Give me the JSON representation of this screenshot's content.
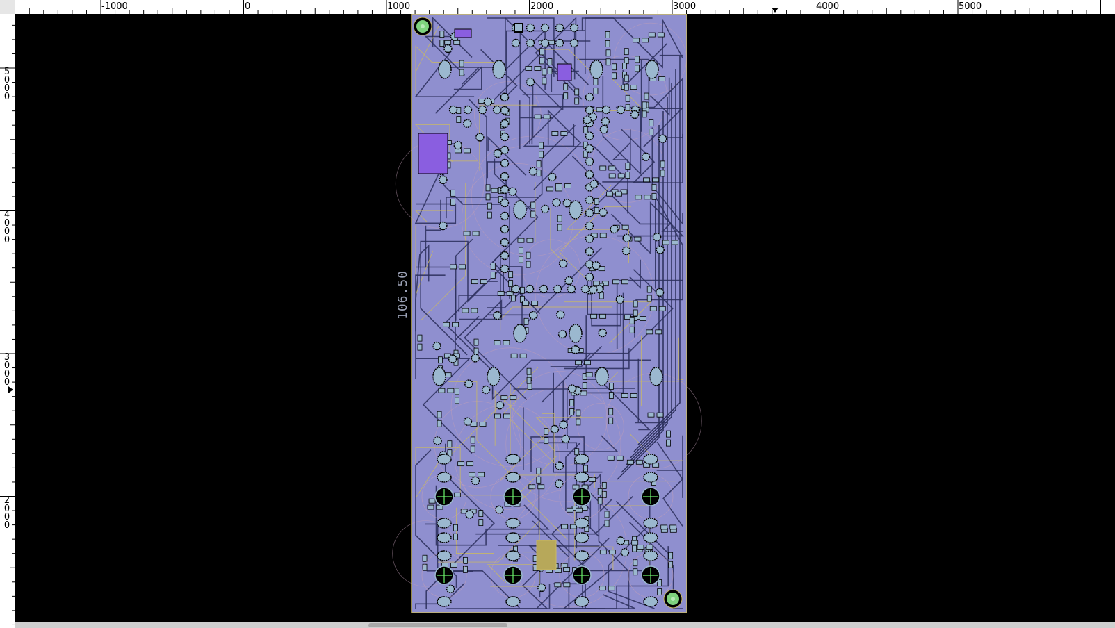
{
  "rulers": {
    "top_labels": [
      "-1000",
      "0",
      "1000",
      "2000",
      "3000",
      "4000",
      "5000"
    ],
    "left_labels": [
      "5000",
      "4000",
      "3000",
      "2000"
    ]
  },
  "board": {
    "dimension_label": "106.50",
    "colors": {
      "background": "#000000",
      "board_fill": "#8f8fcf",
      "copper": "#6a6fa8",
      "trace_dark": "#2a2e5a",
      "silk": "#c9b864",
      "pad": "#9bb8cf",
      "mounting_hole": "#7ed27e",
      "ic_pad": "#8a5ee0"
    }
  },
  "icons": {
    "cursor_marker": "triangle-marker-icon",
    "drill_hole": "crosshair-drill-icon"
  }
}
